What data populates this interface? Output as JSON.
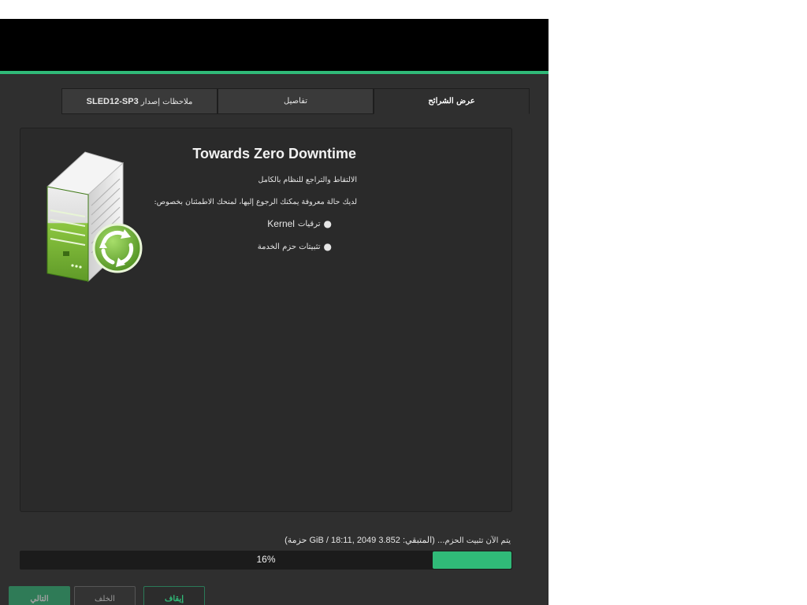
{
  "tabs": [
    {
      "label": "عرض الشرائح"
    },
    {
      "label": "تفاصيل"
    },
    {
      "label_prefix": "ملاحظات إصدار",
      "label_product": "SLED12-SP3"
    }
  ],
  "slide": {
    "title": "Towards Zero Downtime",
    "line1": "الالتقاط والتراجع للنظام بالكامل",
    "line2": "لديك حالة معروفة يمكنك الرجوع إليها، لمنحك الاطمئنان بخصوص:",
    "bullets": [
      {
        "arabic": "ترقيات",
        "latin": "Kernel"
      },
      {
        "arabic": "تثبيتات حزم الخدمة",
        "latin": ""
      }
    ]
  },
  "status": {
    "prefix": "يتم الآن تثبيت الحزم...",
    "remaining": "(المتبقي: 3.852 GiB / 18:11, 2049 حزمة)"
  },
  "progress": {
    "percent": 16,
    "label": "16%"
  },
  "buttons": {
    "next": "التالي",
    "back": "الخلف",
    "abort": "إيقاف"
  },
  "colors": {
    "accent": "#30ba78",
    "titlebar": "#000000",
    "window_bg": "#2f2f2f"
  },
  "icons": {
    "slide_image": "server-with-refresh-icon"
  }
}
